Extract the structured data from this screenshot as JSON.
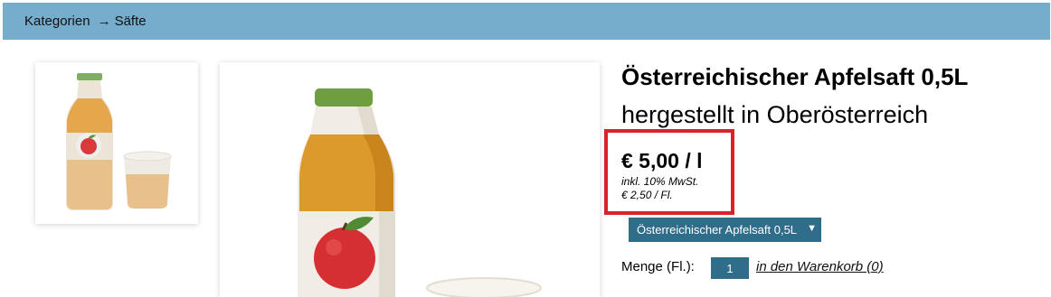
{
  "breadcrumb": {
    "items": [
      "Kategorien",
      "Säfte"
    ],
    "separator": "→"
  },
  "product": {
    "title": "Österreichischer Apfelsaft 0,5L",
    "subtitle": "hergestellt in Oberösterreich"
  },
  "price": {
    "main": "€ 5,00 / l",
    "tax_note": "inkl. 10% MwSt.",
    "unit_price": "€ 2,50 / Fl."
  },
  "variant": {
    "selected": "Österreichischer Apfelsaft 0,5L"
  },
  "quantity": {
    "label": "Menge (Fl.):",
    "value": "1"
  },
  "cart": {
    "link_label": "in den Warenkorb (0)"
  },
  "colors": {
    "header_bar": "#76adcc",
    "highlight_border": "#d9232b",
    "control_bg": "#2f6d8b"
  }
}
